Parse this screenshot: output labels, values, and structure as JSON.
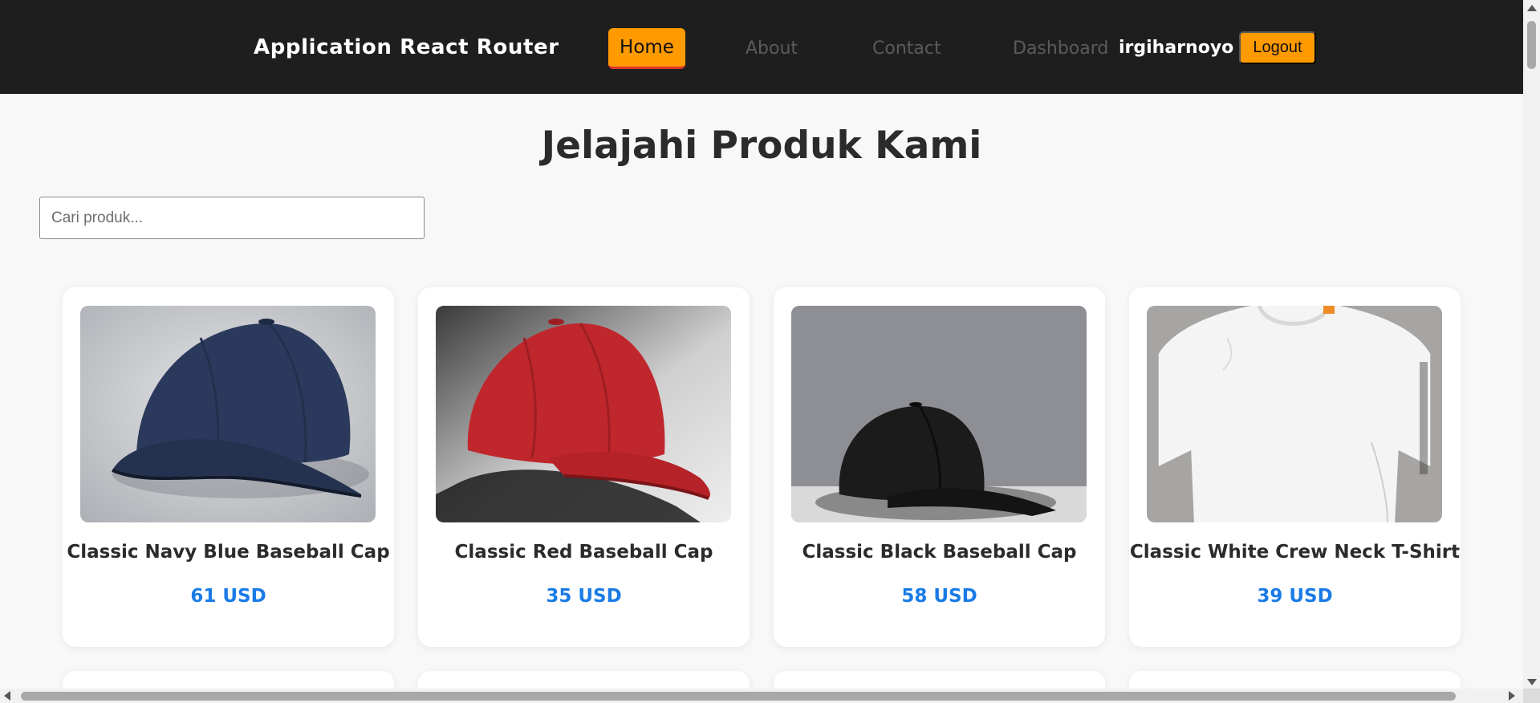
{
  "navbar": {
    "brand": "Application React Router",
    "links": {
      "home": "Home",
      "about": "About",
      "contact": "Contact",
      "dashboard": "Dashboard"
    },
    "username": "irgiharnoyo",
    "logout_label": "Logout",
    "colors": {
      "background": "#1e1e1e",
      "accent": "#ff9a00",
      "active_underline": "#e0332b"
    }
  },
  "main": {
    "title": "Jelajahi Produk Kami",
    "search": {
      "placeholder": "Cari produk...",
      "value": ""
    }
  },
  "products": [
    {
      "name": "Classic Navy Blue Baseball Cap",
      "price": "61 USD",
      "image": "navy-cap-image"
    },
    {
      "name": "Classic Red Baseball Cap",
      "price": "35 USD",
      "image": "red-cap-image"
    },
    {
      "name": "Classic Black Baseball Cap",
      "price": "58 USD",
      "image": "black-cap-image"
    },
    {
      "name": "Classic White Crew Neck T-Shirt",
      "price": "39 USD",
      "image": "white-tshirt-image"
    }
  ],
  "colors": {
    "price": "#1a7be6",
    "page_background": "#f8f8f8"
  }
}
